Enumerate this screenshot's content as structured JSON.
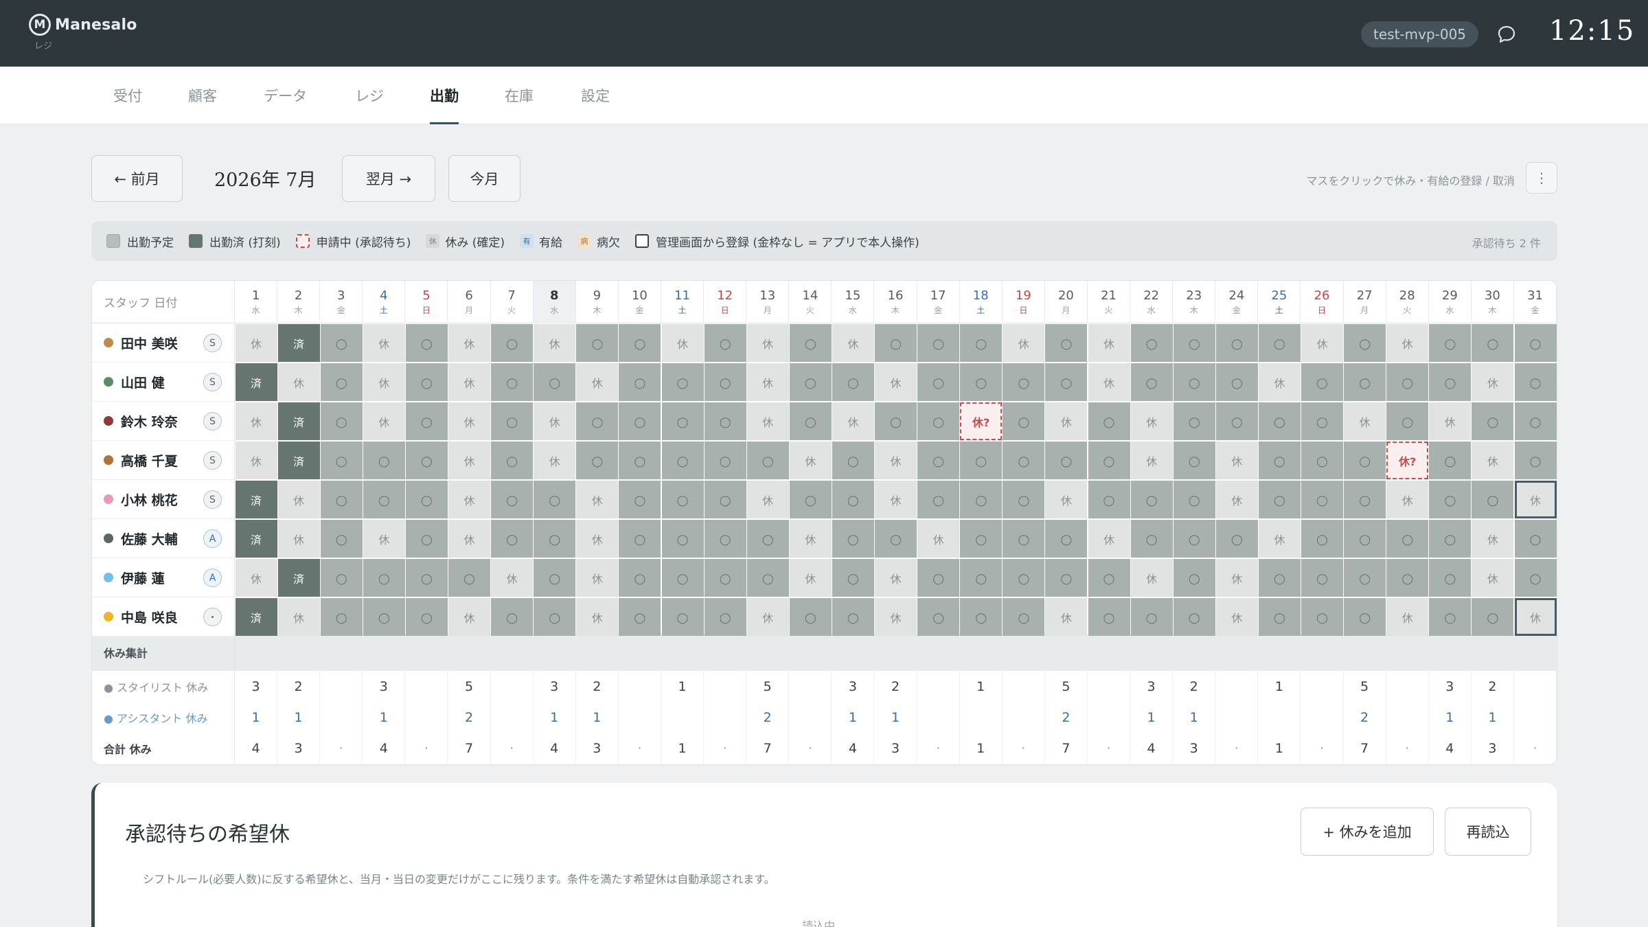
{
  "header": {
    "brand": "Manesalo",
    "brand_sub": "レジ",
    "logo_letter": "M",
    "user": "test-mvp-005",
    "clock": "12:15",
    "icons": [
      "logo-icon",
      "chat-bubble-icon"
    ]
  },
  "tabs": [
    {
      "label": "受付",
      "active": false
    },
    {
      "label": "顧客",
      "active": false
    },
    {
      "label": "データ",
      "active": false
    },
    {
      "label": "レジ",
      "active": false
    },
    {
      "label": "出勤",
      "active": true
    },
    {
      "label": "在庫",
      "active": false
    },
    {
      "label": "設定",
      "active": false
    }
  ],
  "toolbar": {
    "prev_label": "← 前月",
    "month_label": "2026年 7月",
    "next_label": "翌月 →",
    "today_label": "今月",
    "hint": "マスをクリックで休み・有給の登録 / 取消",
    "more_label": "⋮"
  },
  "legend": {
    "items": [
      {
        "label": "出勤予定",
        "type": "plan"
      },
      {
        "label": "出勤済 (打刻)",
        "type": "done"
      },
      {
        "label": "申請中 (承認待ち)",
        "type": "pending"
      },
      {
        "label": "休み (確定)",
        "type": "off",
        "mark": "休"
      },
      {
        "label": "有給",
        "type": "paid",
        "mark": "有"
      },
      {
        "label": "病欠",
        "type": "sick",
        "mark": "病"
      },
      {
        "label": "管理画面から登録 (金枠なし = アプリで本人操作)",
        "type": "admin"
      }
    ],
    "pending_count": "承認待ち 2 件"
  },
  "grid": {
    "corner_label": "スタッフ 日付",
    "days": [
      {
        "d": "1",
        "w": "水"
      },
      {
        "d": "2",
        "w": "木"
      },
      {
        "d": "3",
        "w": "金"
      },
      {
        "d": "4",
        "w": "土"
      },
      {
        "d": "5",
        "w": "日"
      },
      {
        "d": "6",
        "w": "月"
      },
      {
        "d": "7",
        "w": "火"
      },
      {
        "d": "8",
        "w": "水"
      },
      {
        "d": "9",
        "w": "木"
      },
      {
        "d": "10",
        "w": "金"
      },
      {
        "d": "11",
        "w": "土"
      },
      {
        "d": "12",
        "w": "日"
      },
      {
        "d": "13",
        "w": "月"
      },
      {
        "d": "14",
        "w": "火"
      },
      {
        "d": "15",
        "w": "水"
      },
      {
        "d": "16",
        "w": "木"
      },
      {
        "d": "17",
        "w": "金"
      },
      {
        "d": "18",
        "w": "土"
      },
      {
        "d": "19",
        "w": "日"
      },
      {
        "d": "20",
        "w": "月"
      },
      {
        "d": "21",
        "w": "火"
      },
      {
        "d": "22",
        "w": "水"
      },
      {
        "d": "23",
        "w": "木"
      },
      {
        "d": "24",
        "w": "金"
      },
      {
        "d": "25",
        "w": "土"
      },
      {
        "d": "26",
        "w": "日"
      },
      {
        "d": "27",
        "w": "月"
      },
      {
        "d": "28",
        "w": "火"
      },
      {
        "d": "29",
        "w": "水"
      },
      {
        "d": "30",
        "w": "木"
      },
      {
        "d": "31",
        "w": "金"
      }
    ],
    "today_index": 7,
    "staff": [
      {
        "name": "田中 美咲",
        "role": "S",
        "color": "#c08a4f",
        "cells": "xDoxoxoxooxoxoxoooxoxooooxoxoo"
      },
      {
        "name": "山田 健",
        "role": "S",
        "color": "#5b8a68",
        "cells": "DxoxoxooxoooxooxooooxoooxooooxoxoX"
      },
      {
        "name": "鈴木 玲奈",
        "role": "S",
        "color": "#8e3a3a",
        "cells": "xDoxoxoxooooxoxooPoxoxooooxoxoo"
      },
      {
        "name": "高橋 千夏",
        "role": "S",
        "color": "#b0733a",
        "cells": "xDoooxoxoooooxoxoooooxoxoooPoxoxoo"
      },
      {
        "name": "小林 桃花",
        "role": "S",
        "color": "#e59ab8",
        "cells": "DxoooxooxoooxooxoooxoooxoooxooXoo"
      },
      {
        "name": "佐藤 大輔",
        "role": "A",
        "color": "#5e6468",
        "cells": "Dxoxoxooxooooxooxoooxoooxooooxoxoo"
      },
      {
        "name": "伊藤 蓮",
        "role": "A",
        "color": "#6fc0ee",
        "cells": "xDooooxoxooooxoxoooooxoxoooooxoxoo"
      },
      {
        "name": "中島 咲良",
        "role": "・",
        "color": "#f0b429",
        "cells": "DxoooxooxoooxooxoooxoooxoooxooXoo"
      }
    ],
    "summary": {
      "title": "休み集計",
      "stylist_label": "● スタイリスト 休み",
      "assistant_label": "● アシスタント 休み",
      "total_label": "合計 休み",
      "stylist": [
        "3",
        "2",
        "",
        "3",
        "",
        "5",
        "",
        "3",
        "2",
        "",
        "1",
        "",
        "5",
        "",
        "3",
        "2",
        "",
        "1",
        "",
        "5",
        "",
        "3",
        "2",
        "",
        "1",
        "",
        "5",
        "",
        "3",
        "2",
        ""
      ],
      "assistant": [
        "1",
        "1",
        "",
        "1",
        "",
        "2",
        "",
        "1",
        "1",
        "",
        "",
        "",
        "2",
        "",
        "1",
        "1",
        "",
        "",
        "",
        "2",
        "",
        "1",
        "1",
        "",
        "",
        "",
        "2",
        "",
        "1",
        "1",
        ""
      ],
      "total": [
        "4",
        "3",
        "·",
        "4",
        "·",
        "7",
        "·",
        "4",
        "3",
        "·",
        "1",
        "·",
        "7",
        "·",
        "4",
        "3",
        "·",
        "1",
        "·",
        "7",
        "·",
        "4",
        "3",
        "·",
        "1",
        "·",
        "7",
        "·",
        "4",
        "3",
        "·"
      ]
    }
  },
  "panel": {
    "title": "承認待ちの希望休",
    "add_label": "+ 休みを追加",
    "reload_label": "再読込",
    "description": "シフトルール(必要人数)に反する希望休と、当月・当日の変更だけがここに残ります。条件を満たす希望休は自動承認されます。",
    "loading": "読込中..."
  },
  "marks": {
    "plan": "○",
    "off": "休",
    "done": "済",
    "pending": "休?"
  }
}
